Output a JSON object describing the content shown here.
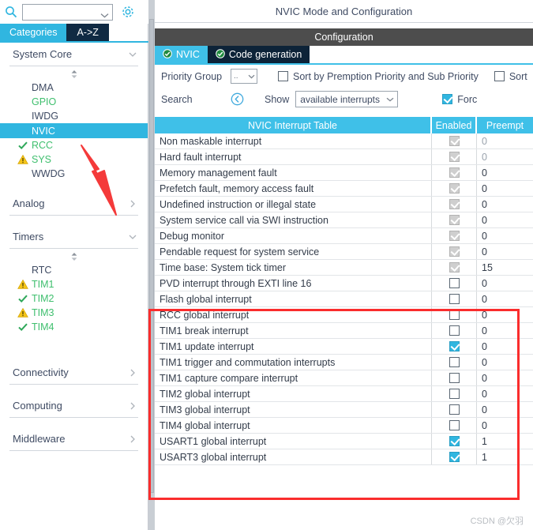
{
  "left_panel": {
    "search": {
      "value": "",
      "placeholder": "",
      "icon": "search-icon"
    },
    "gear_icon": "gear-icon",
    "tabs": [
      {
        "label": "Categories",
        "active": true
      },
      {
        "label": "A->Z",
        "active": false
      }
    ],
    "groups": [
      {
        "name": "System Core",
        "expanded": true,
        "items": [
          {
            "label": "DMA",
            "state": "none",
            "selected": false
          },
          {
            "label": "GPIO",
            "state": "ok-text",
            "selected": false
          },
          {
            "label": "IWDG",
            "state": "none",
            "selected": false
          },
          {
            "label": "NVIC",
            "state": "none",
            "selected": true
          },
          {
            "label": "RCC",
            "state": "check",
            "selected": false
          },
          {
            "label": "SYS",
            "state": "warn",
            "selected": false
          },
          {
            "label": "WWDG",
            "state": "none",
            "selected": false
          }
        ]
      },
      {
        "name": "Analog",
        "expanded": false,
        "items": []
      },
      {
        "name": "Timers",
        "expanded": true,
        "items": [
          {
            "label": "RTC",
            "state": "none",
            "selected": false
          },
          {
            "label": "TIM1",
            "state": "warn",
            "selected": false
          },
          {
            "label": "TIM2",
            "state": "check",
            "selected": false
          },
          {
            "label": "TIM3",
            "state": "warn",
            "selected": false
          },
          {
            "label": "TIM4",
            "state": "check",
            "selected": false
          }
        ]
      },
      {
        "name": "Connectivity",
        "expanded": false,
        "items": []
      },
      {
        "name": "Computing",
        "expanded": false,
        "items": []
      },
      {
        "name": "Middleware",
        "expanded": false,
        "items": []
      }
    ]
  },
  "right_panel": {
    "page_title": "NVIC Mode and Configuration",
    "configuration_label": "Configuration",
    "tabs": [
      {
        "label": "NVIC",
        "active": true
      },
      {
        "label": "Code generation",
        "active": false
      }
    ],
    "priority_group_label": "Priority Group",
    "priority_group_value": "..",
    "sort_preemption_label": "Sort by Premption Priority and Sub Priority",
    "sort_preemption_checked": false,
    "sort_trunc_label": "Sort",
    "sort_trunc_checked": false,
    "search_label": "Search",
    "search_reset_icon": "search-reset-icon",
    "show_label": "Show",
    "show_value": "available interrupts",
    "force_trunc_label": "Forc",
    "force_trunc_checked": true
  },
  "table": {
    "columns": [
      "NVIC Interrupt Table",
      "Enabled",
      "Preempt"
    ],
    "rows": [
      {
        "name": "Non maskable interrupt",
        "enabled": "locked",
        "preempt": "0",
        "dim": true
      },
      {
        "name": "Hard fault interrupt",
        "enabled": "locked",
        "preempt": "0",
        "dim": true
      },
      {
        "name": "Memory management fault",
        "enabled": "locked",
        "preempt": "0",
        "dim": false
      },
      {
        "name": "Prefetch fault, memory access fault",
        "enabled": "locked",
        "preempt": "0",
        "dim": false
      },
      {
        "name": "Undefined instruction or illegal state",
        "enabled": "locked",
        "preempt": "0",
        "dim": false
      },
      {
        "name": "System service call via SWI instruction",
        "enabled": "locked",
        "preempt": "0",
        "dim": false
      },
      {
        "name": "Debug monitor",
        "enabled": "locked",
        "preempt": "0",
        "dim": false
      },
      {
        "name": "Pendable request for system service",
        "enabled": "locked",
        "preempt": "0",
        "dim": false
      },
      {
        "name": "Time base: System tick timer",
        "enabled": "locked",
        "preempt": "15",
        "dim": false
      },
      {
        "name": "PVD interrupt through EXTI line 16",
        "enabled": "unchecked",
        "preempt": "0",
        "dim": false
      },
      {
        "name": "Flash global interrupt",
        "enabled": "unchecked",
        "preempt": "0",
        "dim": false
      },
      {
        "name": "RCC global interrupt",
        "enabled": "unchecked",
        "preempt": "0",
        "dim": false
      },
      {
        "name": "TIM1 break interrupt",
        "enabled": "unchecked",
        "preempt": "0",
        "dim": false
      },
      {
        "name": "TIM1 update interrupt",
        "enabled": "checked",
        "preempt": "0",
        "dim": false
      },
      {
        "name": "TIM1 trigger and commutation interrupts",
        "enabled": "unchecked",
        "preempt": "0",
        "dim": false
      },
      {
        "name": "TIM1 capture compare interrupt",
        "enabled": "unchecked",
        "preempt": "0",
        "dim": false
      },
      {
        "name": "TIM2 global interrupt",
        "enabled": "unchecked",
        "preempt": "0",
        "dim": false
      },
      {
        "name": "TIM3 global interrupt",
        "enabled": "unchecked",
        "preempt": "0",
        "dim": false
      },
      {
        "name": "TIM4 global interrupt",
        "enabled": "unchecked",
        "preempt": "0",
        "dim": false
      },
      {
        "name": "USART1 global interrupt",
        "enabled": "checked",
        "preempt": "1",
        "dim": false
      },
      {
        "name": "USART3 global interrupt",
        "enabled": "checked",
        "preempt": "1",
        "dim": false
      }
    ]
  },
  "annotations": {
    "highlight_color": "#fa2d2d",
    "arrow_target": "NVIC",
    "box_target": "interrupt rows Flash global interrupt through USART3 global interrupt"
  },
  "watermark": {
    "text": "CSDN @欠羽"
  },
  "colors": {
    "accent": "#30b6e0",
    "tab_dark": "#0d2338",
    "header_gray": "#4d4d4d",
    "green": "#3fbf6e",
    "amber": "#f2c218",
    "annotation_red": "#fa2d2d"
  }
}
